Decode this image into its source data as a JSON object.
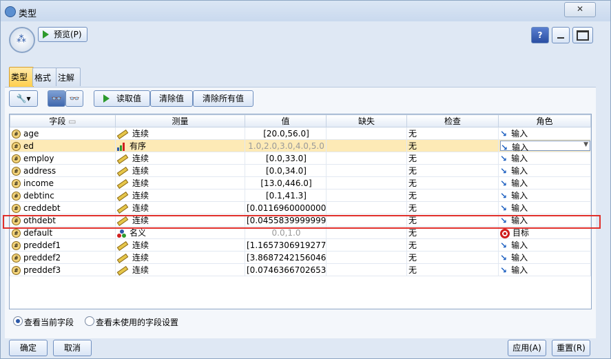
{
  "window": {
    "title": "类型",
    "close_label": "✕"
  },
  "toolbar": {
    "preview_label": "预览(P)",
    "help_label": "?"
  },
  "tabs": [
    {
      "label": "类型",
      "active": true
    },
    {
      "label": "格式",
      "active": false
    },
    {
      "label": "注解",
      "active": false
    }
  ],
  "actions": {
    "read_values": "读取值",
    "clear_values": "清除值",
    "clear_all_values": "清除所有值"
  },
  "table": {
    "headers": [
      "字段",
      "测量",
      "值",
      "缺失",
      "检查",
      "角色"
    ],
    "rows": [
      {
        "field": "age",
        "measure": "连续",
        "measure_icon": "ruler-icon",
        "value": "[20.0,56.0]",
        "missing": "",
        "check": "无",
        "role": "输入",
        "role_icon": "arrow-input-icon"
      },
      {
        "field": "ed",
        "measure": "有序",
        "measure_icon": "ordinal-bars-icon",
        "value": "1.0,2.0,3.0,4.0,5.0",
        "missing": "",
        "check": "无",
        "role": "输入",
        "role_icon": "arrow-input-icon",
        "selected": true
      },
      {
        "field": "employ",
        "measure": "连续",
        "measure_icon": "ruler-icon",
        "value": "[0.0,33.0]",
        "missing": "",
        "check": "无",
        "role": "输入",
        "role_icon": "arrow-input-icon"
      },
      {
        "field": "address",
        "measure": "连续",
        "measure_icon": "ruler-icon",
        "value": "[0.0,34.0]",
        "missing": "",
        "check": "无",
        "role": "输入",
        "role_icon": "arrow-input-icon"
      },
      {
        "field": "income",
        "measure": "连续",
        "measure_icon": "ruler-icon",
        "value": "[13.0,446.0]",
        "missing": "",
        "check": "无",
        "role": "输入",
        "role_icon": "arrow-input-icon"
      },
      {
        "field": "debtinc",
        "measure": "连续",
        "measure_icon": "ruler-icon",
        "value": "[0.1,41.3]",
        "missing": "",
        "check": "无",
        "role": "输入",
        "role_icon": "arrow-input-icon"
      },
      {
        "field": "creddebt",
        "measure": "连续",
        "measure_icon": "ruler-icon",
        "value": "[0.0116960000000...",
        "missing": "",
        "check": "无",
        "role": "输入",
        "role_icon": "arrow-input-icon"
      },
      {
        "field": "othdebt",
        "measure": "连续",
        "measure_icon": "ruler-icon",
        "value": "[0.0455839999999...",
        "missing": "",
        "check": "无",
        "role": "输入",
        "role_icon": "arrow-input-icon"
      },
      {
        "field": "default",
        "measure": "名义",
        "measure_icon": "nominal-dots-icon",
        "value": "0.0,1.0",
        "missing": "",
        "check": "无",
        "role": "目标",
        "role_icon": "target-icon"
      },
      {
        "field": "preddef1",
        "measure": "连续",
        "measure_icon": "ruler-icon",
        "value": "[1.1657306919277...",
        "missing": "",
        "check": "无",
        "role": "输入",
        "role_icon": "arrow-input-icon"
      },
      {
        "field": "preddef2",
        "measure": "连续",
        "measure_icon": "ruler-icon",
        "value": "[3.8687242156046...",
        "missing": "",
        "check": "无",
        "role": "输入",
        "role_icon": "arrow-input-icon"
      },
      {
        "field": "preddef3",
        "measure": "连续",
        "measure_icon": "ruler-icon",
        "value": "[0.0746366702653...",
        "missing": "",
        "check": "无",
        "role": "输入",
        "role_icon": "arrow-input-icon"
      }
    ]
  },
  "view_options": {
    "current": "查看当前字段",
    "unused": "查看未使用的字段设置"
  },
  "buttons": {
    "ok": "确定",
    "cancel": "取消",
    "apply": "应用(A)",
    "reset": "重置(R)"
  },
  "colors": {
    "highlight": "#e0302b",
    "selected_row": "#fdeab6",
    "active_tab": "#ffcf4d"
  }
}
